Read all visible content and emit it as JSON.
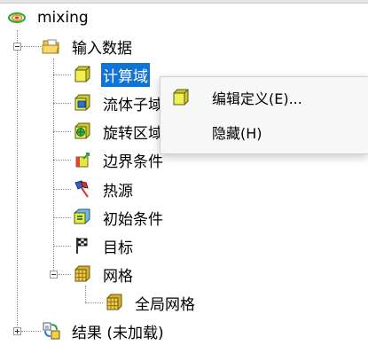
{
  "tree": {
    "root": {
      "label": "mixing",
      "icon": "project-icon"
    },
    "input": {
      "label": "输入数据",
      "icon": "folder-open-icon",
      "expanded": true
    },
    "items": [
      {
        "label": "计算域",
        "icon": "domain-icon",
        "selected": true
      },
      {
        "label": "流体子域",
        "icon": "fluid-subdomain-icon"
      },
      {
        "label": "旋转区域",
        "icon": "rotating-region-icon"
      },
      {
        "label": "边界条件",
        "icon": "boundary-condition-icon"
      },
      {
        "label": "热源",
        "icon": "heat-source-icon"
      },
      {
        "label": "初始条件",
        "icon": "initial-condition-icon"
      },
      {
        "label": "目标",
        "icon": "goal-flag-icon"
      }
    ],
    "mesh": {
      "label": "网格",
      "icon": "mesh-icon",
      "expanded": true
    },
    "global_mesh": {
      "label": "全局网格",
      "icon": "global-mesh-icon"
    },
    "results": {
      "label": "结果 (未加载)",
      "icon": "results-icon",
      "expanded": false
    }
  },
  "context_menu": {
    "items": [
      {
        "label": "编辑定义(E)...",
        "icon": "domain-icon"
      },
      {
        "label": "隐藏(H)",
        "icon": ""
      }
    ]
  },
  "colors": {
    "selection": "#0f74d6",
    "domain_yellow": "#e8e83a",
    "menu_bg": "#f7f7f7"
  }
}
